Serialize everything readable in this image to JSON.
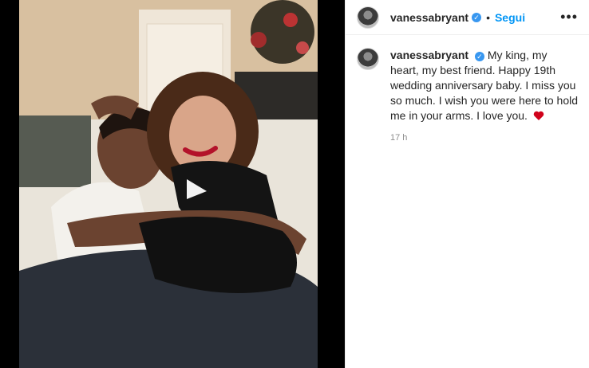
{
  "post": {
    "username": "vanessabryant",
    "follow_label": "Segui",
    "more_icon": "more-options-icon",
    "verified_icon": "verified-badge-icon"
  },
  "comment": {
    "username": "vanessabryant",
    "text": "My king, my heart, my best friend. Happy 19th wedding anniversary baby. I miss you so much. I wish you were here to hold me in your arms. I love you.",
    "emoji": "heart-icon",
    "timestamp": "17 h"
  },
  "colors": {
    "link": "#0095f6",
    "verified": "#3897f0",
    "heart": "#d0021b"
  }
}
